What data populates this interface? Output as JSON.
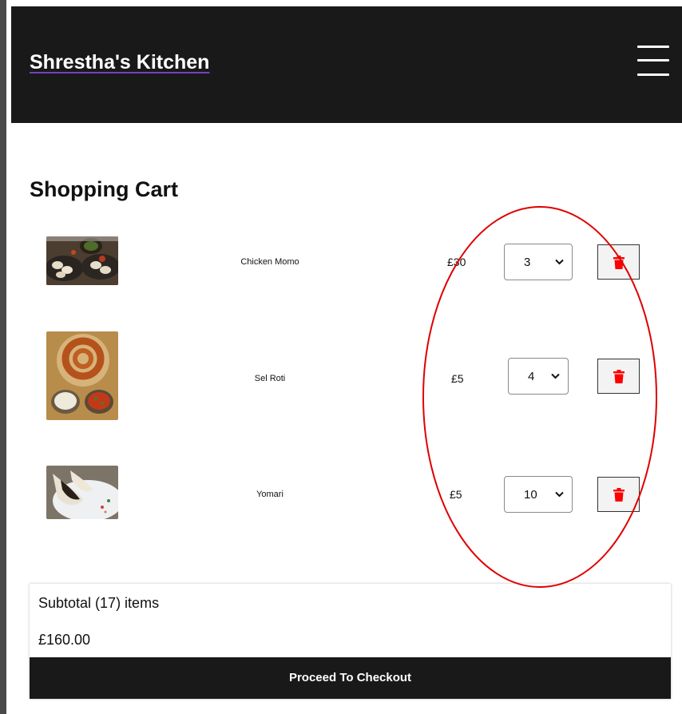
{
  "header": {
    "brand": "Shrestha's Kitchen",
    "menu_icon": "hamburger-menu-icon"
  },
  "cart": {
    "title": "Shopping Cart",
    "items": [
      {
        "name": "Chicken Momo",
        "price": "£30",
        "quantity": "3",
        "image": "chicken-momo-photo",
        "delete_icon": "trash-icon"
      },
      {
        "name": "Sel Roti",
        "price": "£5",
        "quantity": "4",
        "image": "sel-roti-photo",
        "delete_icon": "trash-icon"
      },
      {
        "name": "Yomari",
        "price": "£5",
        "quantity": "10",
        "image": "yomari-photo",
        "delete_icon": "trash-icon"
      }
    ]
  },
  "summary": {
    "subtotal_label": "Subtotal (17) items",
    "subtotal_value": "£160.00",
    "checkout_label": "Proceed To Checkout"
  },
  "colors": {
    "header_bg": "#191919",
    "delete_icon": "#ff0000",
    "annotation": "#e00000"
  }
}
